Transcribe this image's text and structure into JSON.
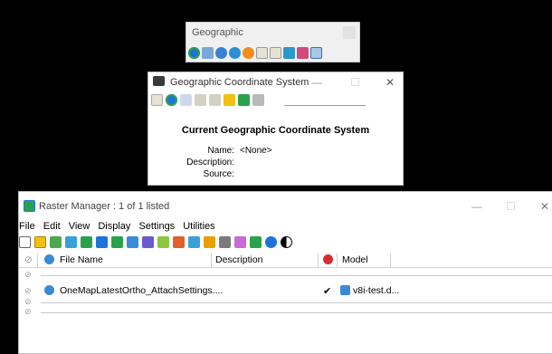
{
  "geographic_toolbar": {
    "title": "Geographic",
    "icons": [
      "globe-icon",
      "satellite-icon",
      "search-globe-icon",
      "globe-settings-icon",
      "coordinate-icon",
      "export-icon",
      "import-icon",
      "globe-folder-icon",
      "globe-link-icon",
      "map-icon"
    ]
  },
  "gcs_dialog": {
    "title": "Geographic Coordinate System",
    "minimize": "—",
    "maximize": "☐",
    "close": "✕",
    "heading": "Current Geographic Coordinate System",
    "name_label": "Name:",
    "name_value": "<None>",
    "description_label": "Description:",
    "description_value": "",
    "source_label": "Source:",
    "source_value": ""
  },
  "raster_manager": {
    "title": "Raster Manager : 1 of 1 listed",
    "minimize": "—",
    "maximize": "☐",
    "close": "✕",
    "menu": [
      "File",
      "Edit",
      "View",
      "Display",
      "Settings",
      "Utilities"
    ],
    "columns": {
      "file_name": "File Name",
      "description": "Description",
      "model": "Model"
    },
    "rows": [
      {
        "file_name": "OneMapLatestOrtho_AttachSettings....",
        "description": "",
        "check": "✔",
        "model": "v8i-test.d..."
      }
    ]
  },
  "colors": {
    "background": "#000000",
    "window": "#ffffff",
    "toolbar_panel": "#f0f0f0",
    "accent_blue": "#1e73d8",
    "accent_green": "#2aa24b",
    "accent_yellow": "#f2c010",
    "accent_red": "#d62e2e"
  }
}
